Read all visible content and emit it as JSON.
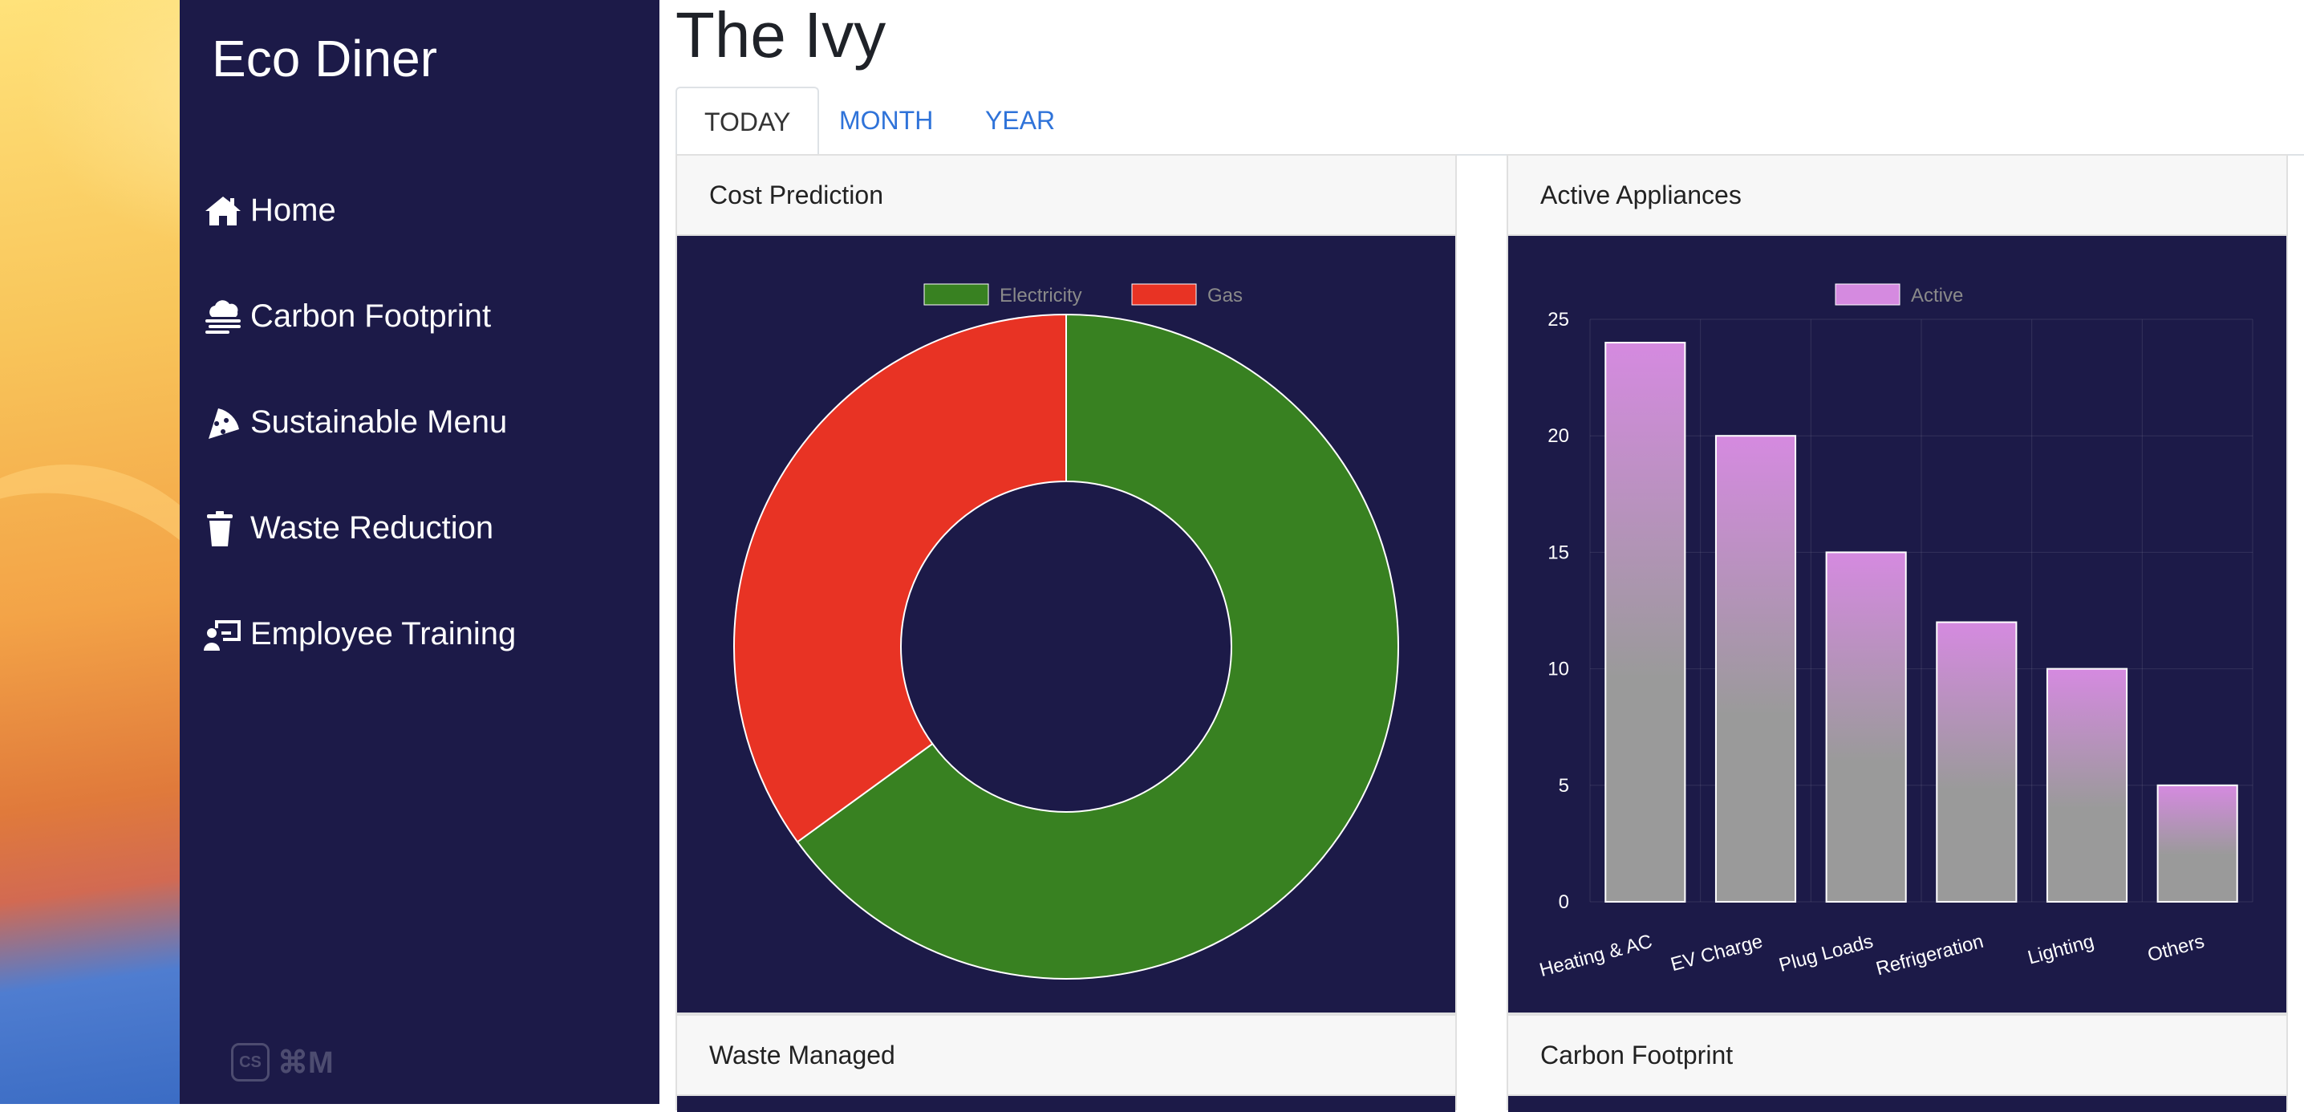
{
  "app": {
    "brand": "Eco Diner"
  },
  "sidebar": {
    "items": [
      {
        "label": "Home",
        "icon": "home-icon"
      },
      {
        "label": "Carbon Footprint",
        "icon": "cloud-icon"
      },
      {
        "label": "Sustainable Menu",
        "icon": "pizza-icon"
      },
      {
        "label": "Waste Reduction",
        "icon": "trash-icon"
      },
      {
        "label": "Employee Training",
        "icon": "presentation-icon"
      }
    ],
    "shortcut_hint": "⌘M",
    "shortcut_badge": "CS"
  },
  "page": {
    "title": "The Ivy"
  },
  "tabs": [
    {
      "label": "TODAY",
      "active": true
    },
    {
      "label": "MONTH",
      "active": false
    },
    {
      "label": "YEAR",
      "active": false
    }
  ],
  "cards": {
    "cost": {
      "title": "Cost Prediction"
    },
    "appliances": {
      "title": "Active Appliances"
    },
    "waste": {
      "title": "Waste Managed"
    },
    "carbon": {
      "title": "Carbon Footprint"
    }
  },
  "colors": {
    "sidebar_bg": "#1c1a48",
    "electricity": "#388121",
    "gas": "#e83324",
    "bar_top": "#d58ae0",
    "bar_bottom": "#9a9a9a",
    "tab_link": "#2f73d9"
  },
  "chart_data": [
    {
      "type": "doughnut",
      "title": "",
      "legend": [
        "Electricity",
        "Gas"
      ],
      "legend_position": "top",
      "categories": [
        "Electricity",
        "Gas"
      ],
      "values": [
        65,
        35
      ],
      "colors": [
        "#388121",
        "#e83324"
      ]
    },
    {
      "type": "bar",
      "title": "",
      "legend": [
        "Active"
      ],
      "legend_position": "top",
      "categories": [
        "Heating & AC",
        "EV Charge",
        "Plug Loads",
        "Refrigeration",
        "Lighting",
        "Others"
      ],
      "series": [
        {
          "name": "Active",
          "values": [
            24,
            20,
            15,
            12,
            10,
            5
          ]
        }
      ],
      "ylim": [
        0,
        25
      ],
      "yticks": [
        0,
        5,
        10,
        15,
        20,
        25
      ],
      "grid": true
    }
  ]
}
